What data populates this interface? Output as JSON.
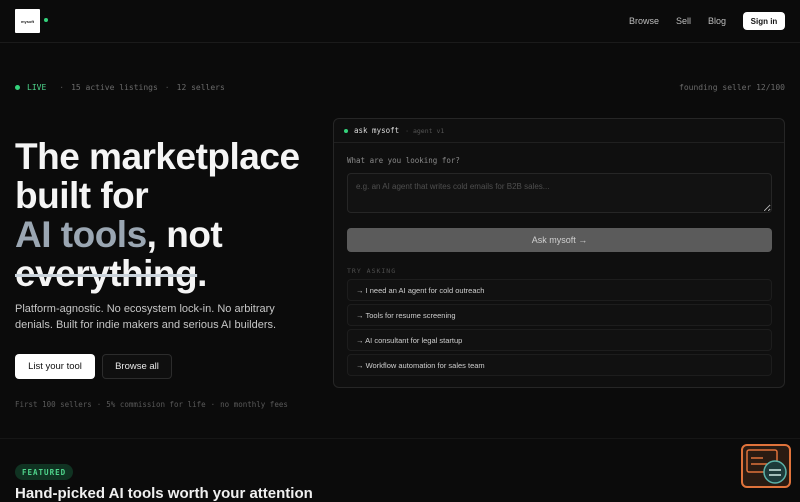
{
  "nav": {
    "logo_text": "mysoft",
    "links": [
      "Browse",
      "Sell",
      "Blog"
    ],
    "signin_label": "Sign in"
  },
  "status": {
    "live_label": "LIVE",
    "active_listings": "15 active listings",
    "sellers": "12 sellers",
    "sep": "·",
    "founding": "founding seller 12/100"
  },
  "hero": {
    "title_line1": "The marketplace",
    "title_line2": "built for",
    "title_muted": "AI tools",
    "title_rest": ", not",
    "title_strike": "everything",
    "title_period": ".",
    "subtitle": "Platform-agnostic. No ecosystem lock-in. No arbitrary denials. Built for indie makers and serious AI builders.",
    "primary_cta": "List your tool",
    "secondary_cta": "Browse all",
    "fineprint": [
      "First 100 sellers",
      "5% commission for life",
      "no monthly fees"
    ]
  },
  "ask_panel": {
    "title": "ask mysoft",
    "subtitle": "· agent v1",
    "question_label": "What are you looking for?",
    "input_placeholder": "e.g. an AI agent that writes cold emails for B2B sales...",
    "button_label": "Ask mysoft →",
    "try_label": "TRY ASKING",
    "suggestions": [
      "→ I need an AI agent for cold outreach",
      "→ Tools for resume screening",
      "→ AI consultant for legal startup",
      "→ Workflow automation for sales team"
    ]
  },
  "featured": {
    "badge": "FEATURED",
    "title": "Hand-picked AI tools worth your attention"
  },
  "colors": {
    "accent_green": "#34d27b",
    "widget_orange": "#e0733b",
    "background": "#0b0b0b"
  },
  "icons": {
    "widget": "chat-assistant-icon"
  }
}
